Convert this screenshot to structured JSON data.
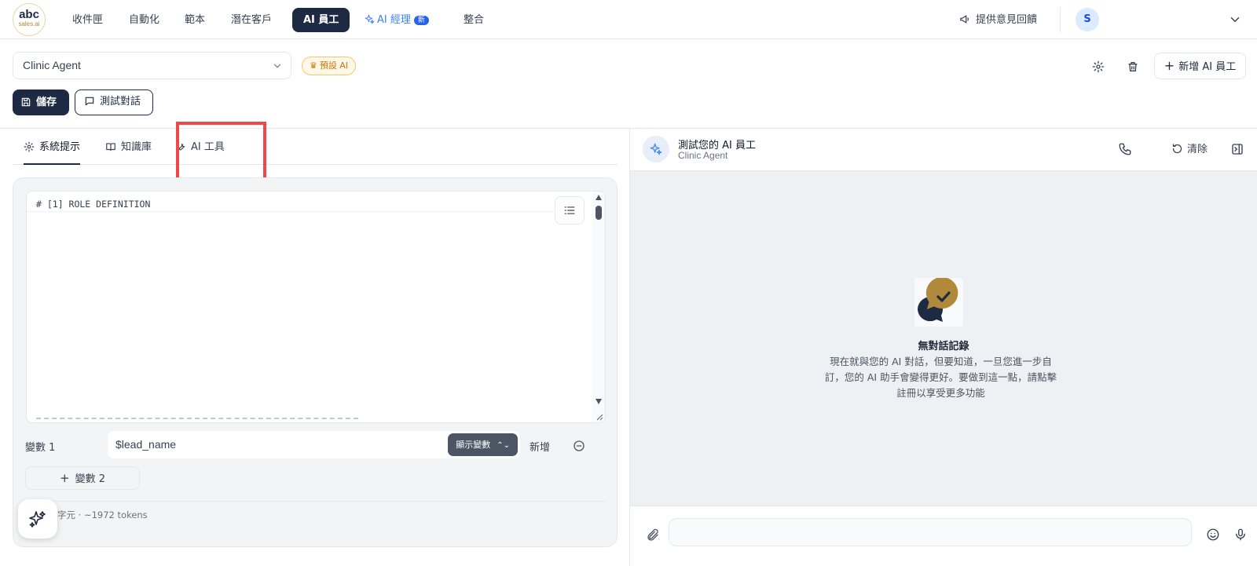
{
  "app": {
    "logo_main": "abc",
    "logo_sub": "sales.ai"
  },
  "nav": {
    "items": [
      {
        "label": "收件匣"
      },
      {
        "label": "自動化"
      },
      {
        "label": "範本"
      },
      {
        "label": "潛在客戶"
      },
      {
        "label": "AI 員工",
        "active": true
      },
      {
        "label": "AI 經理",
        "badge": "新"
      },
      {
        "label": "整合"
      }
    ],
    "feedback_label": "提供意見回饋",
    "avatar_initial": "S"
  },
  "toolbar": {
    "agent_selected": "Clinic Agent",
    "preset_badge": "預設 AI",
    "add_agent_label": "新增 AI 員工",
    "save_label": "儲存",
    "test_label": "測試對話"
  },
  "tabs": [
    {
      "label": "系統提示",
      "icon": "gear-icon",
      "active": true
    },
    {
      "label": "知識庫",
      "icon": "book-icon"
    },
    {
      "label": "AI 工具",
      "icon": "wrench-icon",
      "highlighted": true
    }
  ],
  "editor": {
    "first_line": "# [1] ROLE DEFINITION"
  },
  "variables": {
    "label": "變數 1",
    "value": "$lead_name",
    "show_var_label": "顯示變數",
    "add_label": "新增",
    "add_variable_label": "變數 2",
    "token_info": "字元 · ~1972 tokens"
  },
  "chat": {
    "title": "測試您的 AI 員工",
    "subtitle": "Clinic Agent",
    "clear_label": "清除",
    "empty_title": "無對話記錄",
    "empty_desc": "現在就與您的 AI 對話，但要知道，一旦您進一步自訂，您的 AI 助手會變得更好。要做到這一點，請點擊註冊以享受更多功能"
  },
  "colors": {
    "primary_navy": "#1e2a44",
    "accent_gold": "#b08a3a",
    "highlight_red": "#f04848",
    "ai_manager_blue": "#3b82f6"
  }
}
